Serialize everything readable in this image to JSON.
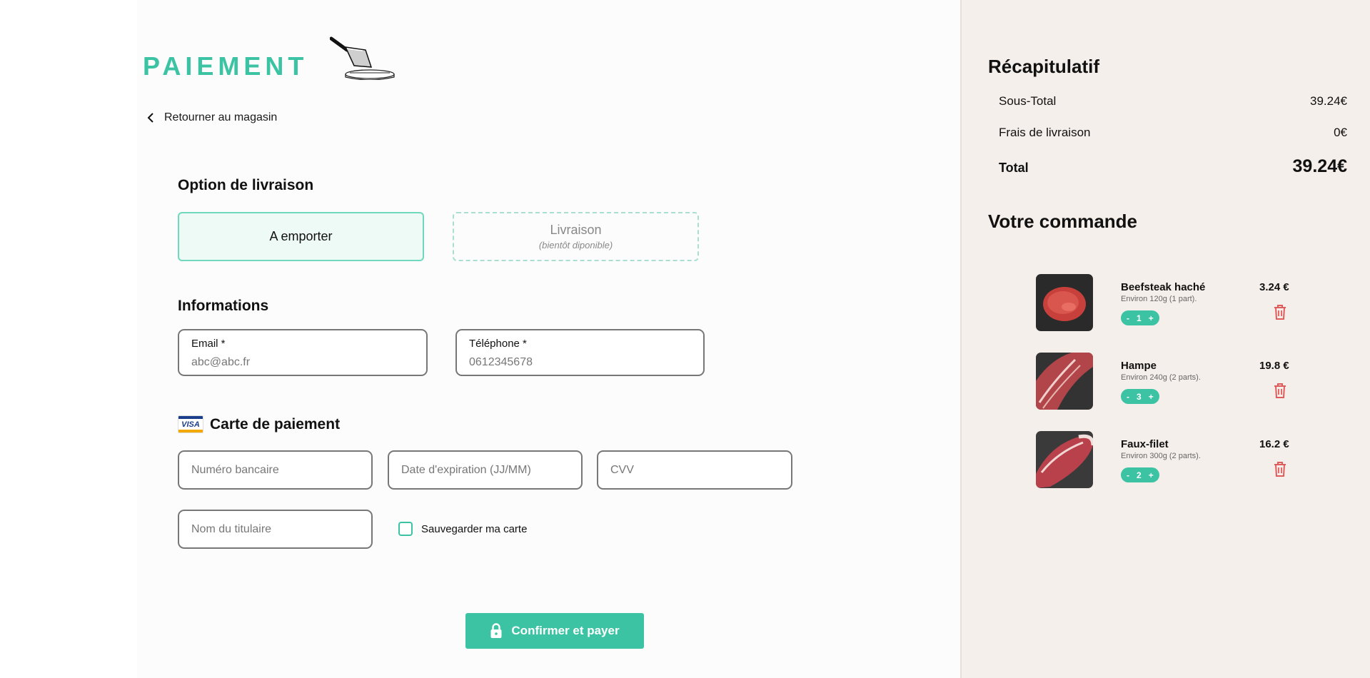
{
  "brand": {
    "title": "PAIEMENT"
  },
  "nav": {
    "back_label": "Retourner au magasin"
  },
  "delivery": {
    "title": "Option de livraison",
    "option_pickup": "A emporter",
    "option_delivery": "Livraison",
    "option_delivery_note": "(bientôt diponible)"
  },
  "info": {
    "title": "Informations",
    "email_label": "Email *",
    "email_placeholder": "abc@abc.fr",
    "phone_label": "Téléphone *",
    "phone_placeholder": "0612345678"
  },
  "card": {
    "logo_text": "VISA",
    "title": "Carte de paiement",
    "number_placeholder": "Numéro bancaire",
    "expiry_placeholder": "Date d'expiration (JJ/MM)",
    "cvv_placeholder": "CVV",
    "holder_placeholder": "Nom du titulaire",
    "save_label": "Sauvegarder ma carte",
    "save_checked": false
  },
  "actions": {
    "pay_label": "Confirmer et payer"
  },
  "summary": {
    "title": "Récapitulatif",
    "subtotal_label": "Sous-Total",
    "subtotal_value": "39.24€",
    "shipping_label": "Frais de livraison",
    "shipping_value": "0€",
    "total_label": "Total",
    "total_value": "39.24€"
  },
  "order": {
    "title": "Votre commande",
    "items": [
      {
        "name": "Beefsteak haché",
        "desc": "Environ 120g (1 part).",
        "qty": "1",
        "minus": "-",
        "plus": "+",
        "price": "3.24 €"
      },
      {
        "name": "Hampe",
        "desc": "Environ 240g (2 parts).",
        "qty": "3",
        "minus": "-",
        "plus": "+",
        "price": "19.8 €"
      },
      {
        "name": "Faux-filet",
        "desc": "Environ 300g (2 parts).",
        "qty": "2",
        "minus": "-",
        "plus": "+",
        "price": "16.2 €"
      }
    ]
  },
  "colors": {
    "accent": "#3cc3a4",
    "sidebar_bg": "#f5efeb",
    "trash": "#e15b5b"
  }
}
